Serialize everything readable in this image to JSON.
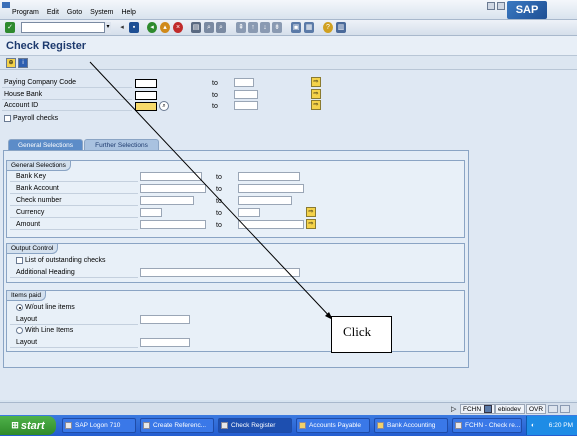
{
  "menubar": {
    "items": [
      "Program",
      "Edit",
      "Goto",
      "System",
      "Help"
    ],
    "logo": "SAP"
  },
  "icons": {
    "enter": "check-icon",
    "save": "save-icon",
    "back": "back-icon",
    "exit": "exit-icon",
    "cancel": "cancel-icon",
    "print": "print-icon",
    "find": "find-icon",
    "help": "help-icon",
    "execute": "execute-icon",
    "info": "info-icon"
  },
  "header": {
    "title": "Check Register"
  },
  "selection": {
    "rows": [
      {
        "label": "Paying Company Code",
        "to": "to"
      },
      {
        "label": "House Bank",
        "to": "to"
      },
      {
        "label": "Account ID",
        "to": "to"
      }
    ],
    "payroll_label": "Payroll checks"
  },
  "tabs": [
    {
      "label": "General Selections"
    },
    {
      "label": "Further Selections"
    }
  ],
  "general": {
    "title": "General Selections",
    "rows": [
      {
        "label": "Bank Key",
        "to": "to"
      },
      {
        "label": "Bank Account",
        "to": "to"
      },
      {
        "label": "Check number",
        "to": "to"
      },
      {
        "label": "Currency",
        "to": "to"
      },
      {
        "label": "Amount",
        "to": "to"
      }
    ]
  },
  "output": {
    "title": "Output Control",
    "outstanding_label": "List of outstanding checks",
    "heading_label": "Additional Heading"
  },
  "items_paid": {
    "title": "Items paid",
    "wout_label": "W/out line items",
    "layout1_label": "Layout",
    "with_label": "With Line Items",
    "layout2_label": "Layout"
  },
  "status": {
    "tx": "FCHN",
    "server": "ebiodev",
    "mode": "OVR"
  },
  "taskbar": {
    "start": "start",
    "items": [
      "SAP Logon 710",
      "Create Referenc...",
      "Check Register",
      "Accounts Payable",
      "Bank Accounting",
      "FCHN - Check re..."
    ],
    "clock": "6:20 PM"
  },
  "annotation": {
    "text": "Click"
  }
}
